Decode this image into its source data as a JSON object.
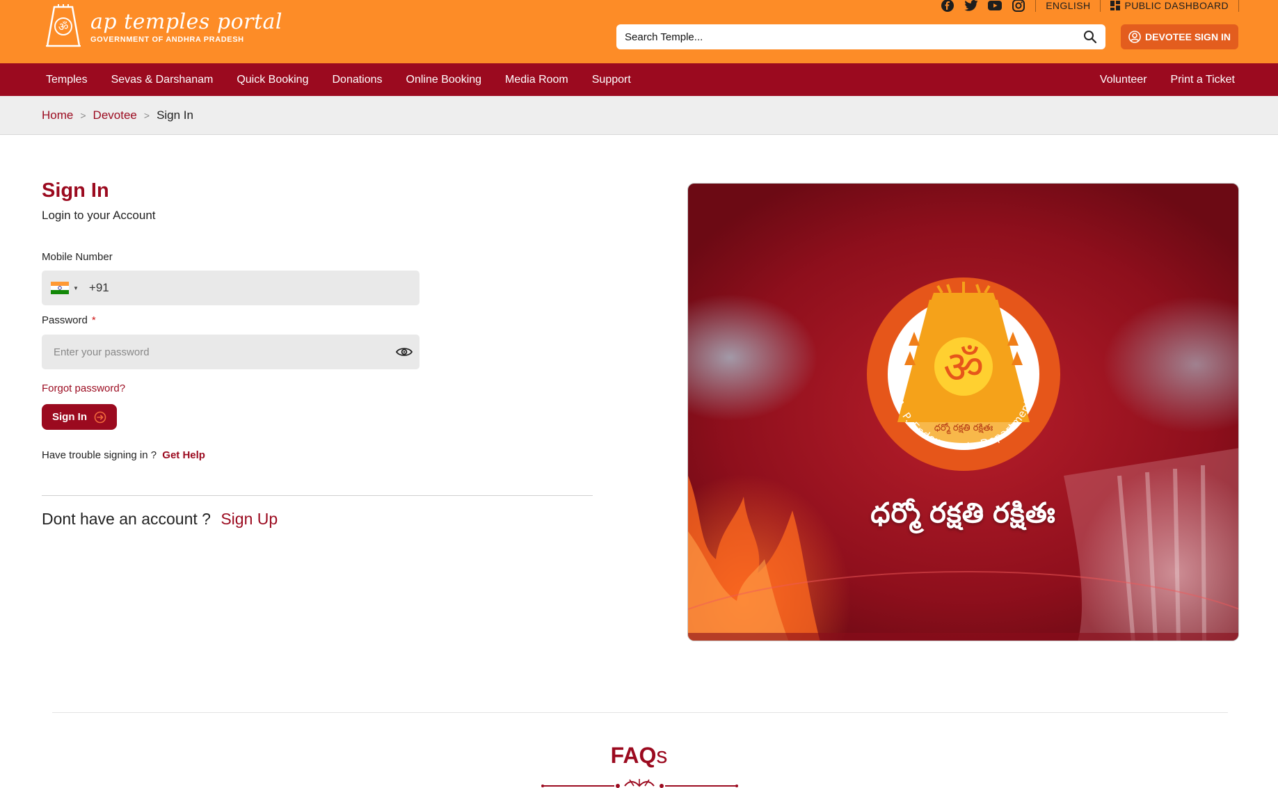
{
  "header": {
    "logo_title": "ap temples portal",
    "logo_subtitle": "GOVERNMENT OF ANDHRA PRADESH",
    "social_icons": [
      "facebook-icon",
      "twitter-icon",
      "youtube-icon",
      "instagram-icon"
    ],
    "language": "ENGLISH",
    "public_dashboard": "PUBLIC DASHBOARD",
    "search_placeholder": "Search Temple...",
    "devotee_sign_in": "DEVOTEE SIGN IN"
  },
  "nav": {
    "left": [
      "Temples",
      "Sevas & Darshanam",
      "Quick Booking",
      "Donations",
      "Online Booking",
      "Media Room",
      "Support"
    ],
    "right": [
      "Volunteer",
      "Print a Ticket"
    ]
  },
  "breadcrumb": {
    "home": "Home",
    "devotee": "Devotee",
    "current": "Sign In",
    "separator": ">"
  },
  "signin": {
    "title": "Sign In",
    "subtitle": "Login to your Account",
    "mobile_label": "Mobile Number",
    "dial_code": "+91",
    "password_label": "Password",
    "required_mark": "*",
    "password_placeholder": "Enter your password",
    "forgot": "Forgot password?",
    "button": "Sign In",
    "trouble_text": "Have trouble signing in ?",
    "get_help": "Get Help",
    "no_account": "Dont have an account ?",
    "sign_up": "Sign Up"
  },
  "banner": {
    "tagline": "ధర్మో రక్షతి రక్షితః",
    "emblem_outer_text": "A. P. Endowments Department",
    "emblem_inner_text": "ధర్మో రక్షతి రక్షితః"
  },
  "faq": {
    "title_main": "FAQ",
    "title_suffix": "s"
  },
  "colors": {
    "header_orange": "#fd8c27",
    "maroon": "#9b0a1f",
    "devotee_button": "#e35d1e"
  }
}
